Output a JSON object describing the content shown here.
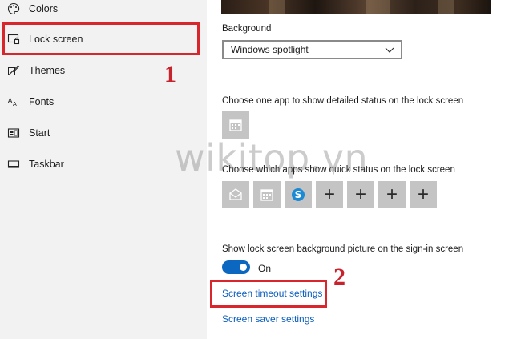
{
  "sidebar": {
    "items": [
      {
        "label": "Colors",
        "icon": "palette-icon"
      },
      {
        "label": "Lock screen",
        "icon": "lock-screen-icon"
      },
      {
        "label": "Themes",
        "icon": "themes-brush-icon"
      },
      {
        "label": "Fonts",
        "icon": "fonts-icon"
      },
      {
        "label": "Start",
        "icon": "start-icon"
      },
      {
        "label": "Taskbar",
        "icon": "taskbar-icon"
      }
    ]
  },
  "annotations": {
    "step1": "1",
    "step2": "2",
    "color": "#d9252c"
  },
  "main": {
    "background": {
      "label": "Background",
      "selected": "Windows spotlight"
    },
    "detailed_status": {
      "label": "Choose one app to show detailed status on the lock screen",
      "icon": "calendar-icon"
    },
    "quick_status": {
      "label": "Choose which apps show quick status on the lock screen",
      "tiles": [
        "mail-icon",
        "calendar-icon",
        "skype-icon",
        "plus-icon",
        "plus-icon",
        "plus-icon",
        "plus-icon"
      ],
      "plus_glyph": "+"
    },
    "signin_background": {
      "label": "Show lock screen background picture on the sign-in screen",
      "state": "On",
      "on": true
    },
    "links": {
      "timeout": "Screen timeout settings",
      "saver": "Screen saver settings"
    }
  },
  "watermark": "wikitop.vn",
  "colors": {
    "accent": "#0b67c0",
    "link": "#0b5fbf",
    "tile": "#c4c4c4",
    "sidebar_bg": "#f2f2f2"
  }
}
